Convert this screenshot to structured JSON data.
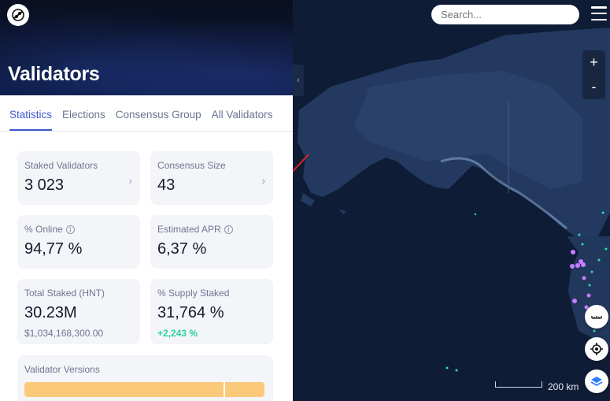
{
  "app": {
    "logo_icon": "helium-logo-icon"
  },
  "hero": {
    "title": "Validators"
  },
  "tabs": [
    {
      "label": "Statistics",
      "active": true
    },
    {
      "label": "Elections",
      "active": false
    },
    {
      "label": "Consensus Group",
      "active": false
    },
    {
      "label": "All Validators",
      "active": false
    }
  ],
  "cards": {
    "staked_validators": {
      "label": "Staked Validators",
      "value": "3 023"
    },
    "consensus_size": {
      "label": "Consensus Size",
      "value": "43"
    },
    "online": {
      "label": "% Online",
      "value": "94,77 %"
    },
    "apr": {
      "label": "Estimated APR",
      "value": "6,37 %"
    },
    "total_staked": {
      "label": "Total Staked (HNT)",
      "value": "30.23M",
      "sub": "$1,034,168,300.00"
    },
    "supply_staked": {
      "label": "% Supply Staked",
      "value": "31,764 %",
      "delta": "+2,243 %"
    }
  },
  "versions": {
    "label": "Validator Versions",
    "bar_color": "#fbc97a"
  },
  "map": {
    "search_placeholder": "Search...",
    "zoom_in": "+",
    "zoom_out": "-",
    "scale_label": "200 km",
    "accent_hotspot": "#c77dff"
  }
}
